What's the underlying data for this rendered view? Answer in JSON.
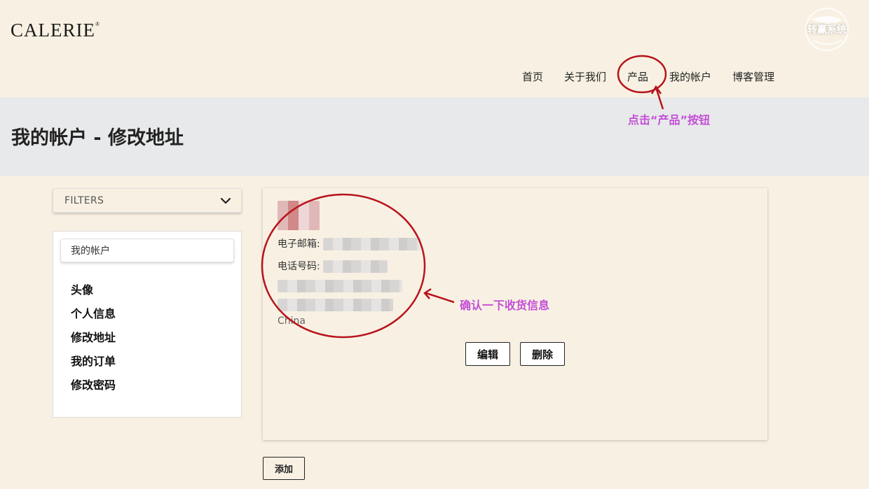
{
  "brand": {
    "logo": "CALERIE",
    "registered": "®"
  },
  "watermark": {
    "text": "转赢系统"
  },
  "nav": {
    "items": [
      {
        "label": "首页"
      },
      {
        "label": "关于我们"
      },
      {
        "label": "产品"
      },
      {
        "label": "我的帐户"
      },
      {
        "label": "博客管理"
      }
    ]
  },
  "page": {
    "title": "我的帐户 - 修改地址"
  },
  "filters": {
    "label": "FILTERS"
  },
  "sidebar": {
    "account_label": "我的帐户",
    "items": [
      {
        "label": "头像"
      },
      {
        "label": "个人信息"
      },
      {
        "label": "修改地址"
      },
      {
        "label": "我的订单"
      },
      {
        "label": "修改密码"
      }
    ]
  },
  "address": {
    "email_label": "电子邮箱:",
    "phone_label": "电话号码:",
    "country": "China",
    "edit_label": "编辑",
    "delete_label": "删除"
  },
  "add_label": "添加",
  "annotations": {
    "product_hint": "点击“产品”按钮",
    "address_hint": "确认一下收货信息"
  },
  "colors": {
    "background": "#f8f1e3",
    "banner": "#e8e9ea",
    "annotation_circle": "#b8141c",
    "annotation_text": "#c44ed8"
  }
}
